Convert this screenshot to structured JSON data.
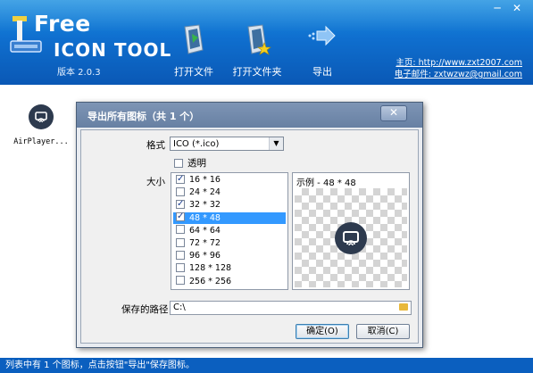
{
  "app": {
    "brand_line1": "Free",
    "brand_line2": "ICON TOOL",
    "version": "版本 2.0.3",
    "minimize": "─",
    "close": "✕"
  },
  "toolbar": {
    "open_file": "打开文件",
    "open_folder": "打开文件夹",
    "export": "导出"
  },
  "contact": {
    "homepage": "主页: http://www.zxt2007.com",
    "email": "电子邮件: zxtwzwz@gmail.com"
  },
  "icon_list": [
    {
      "name": "AirPlayer..."
    }
  ],
  "statusbar": {
    "text": "列表中有 1 个图标，点击按钮\"导出\"保存图标。"
  },
  "dialog": {
    "title": "导出所有图标（共 1 个）",
    "close": "✕",
    "format_label": "格式",
    "format_value": "ICO (*.ico)",
    "transparent_label": "透明",
    "transparent_checked": false,
    "size_label": "大小",
    "sizes": [
      {
        "label": "16 * 16",
        "checked": true,
        "selected": false
      },
      {
        "label": "24 * 24",
        "checked": false,
        "selected": false
      },
      {
        "label": "32 * 32",
        "checked": true,
        "selected": false
      },
      {
        "label": "48 * 48",
        "checked": true,
        "selected": true
      },
      {
        "label": "64 * 64",
        "checked": false,
        "selected": false
      },
      {
        "label": "72 * 72",
        "checked": false,
        "selected": false
      },
      {
        "label": "96 * 96",
        "checked": false,
        "selected": false
      },
      {
        "label": "128 * 128",
        "checked": false,
        "selected": false
      },
      {
        "label": "256 * 256",
        "checked": false,
        "selected": false
      }
    ],
    "preview_label": "示例 - 48 * 48",
    "path_label": "保存的路径",
    "path_value": "C:\\",
    "ok_button": "确定(O)",
    "cancel_button": "取消(C)"
  },
  "colors": {
    "header_blue": "#0f6fcf",
    "statusbar_blue": "#0b5fbf",
    "dialog_title": "#6780a3",
    "selection": "#3399ff",
    "icon_dark": "#2d3a4e"
  }
}
